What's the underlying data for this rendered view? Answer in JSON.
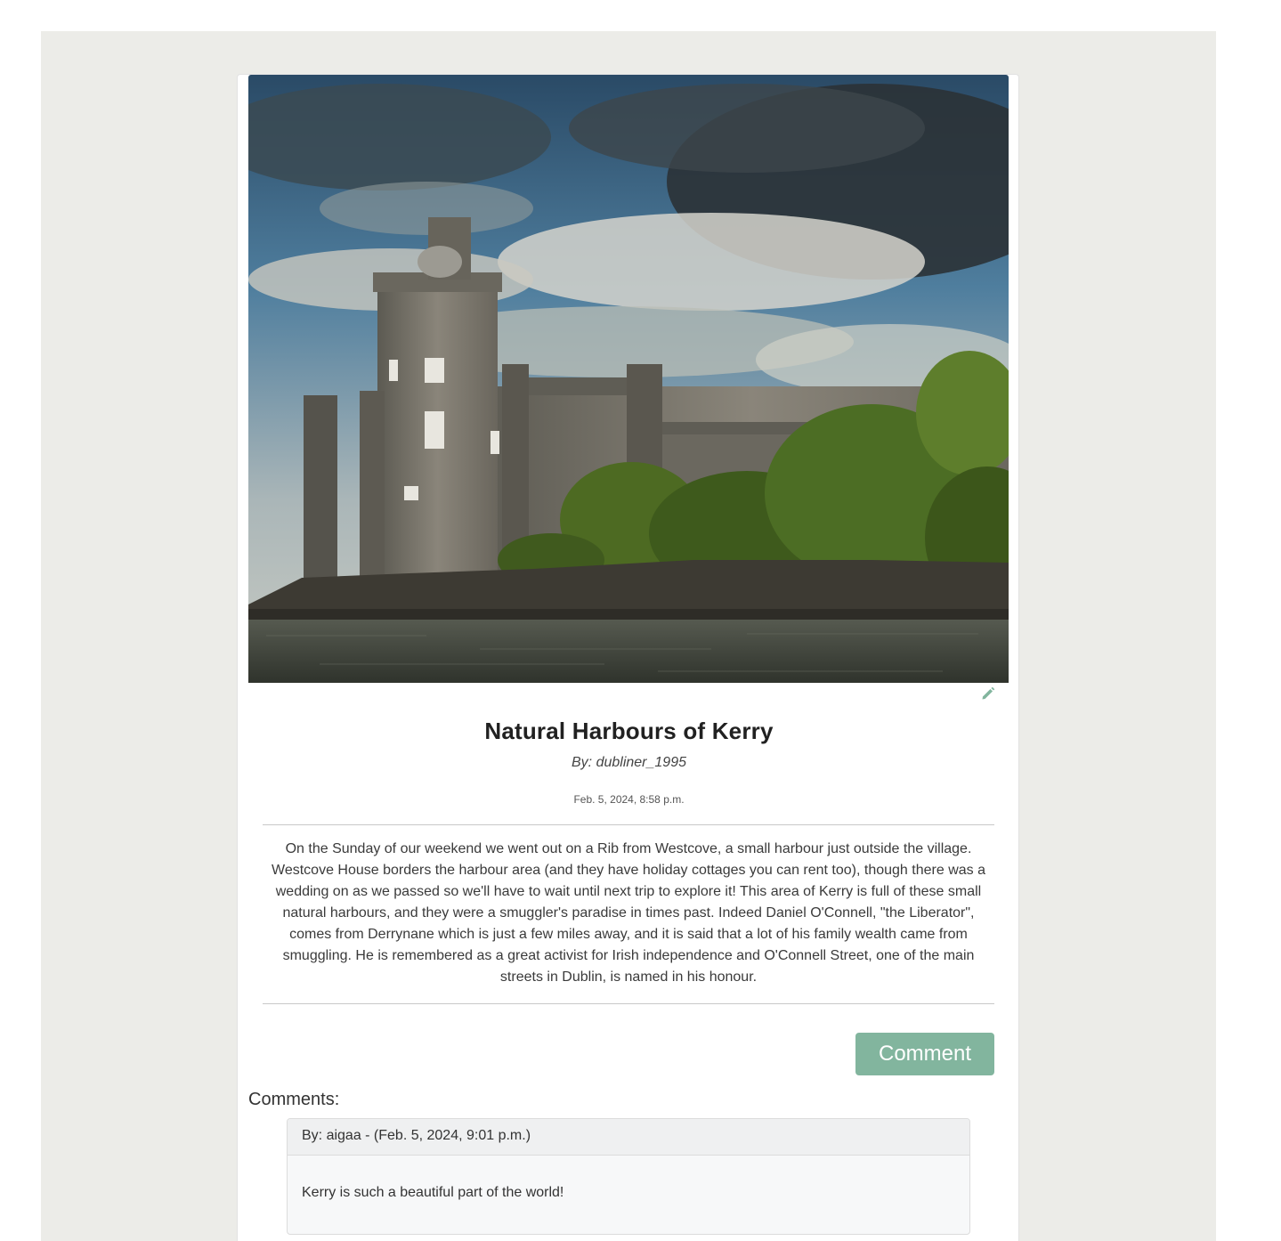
{
  "post": {
    "title": "Natural Harbours of Kerry",
    "author": "By: dubliner_1995",
    "date": "Feb. 5, 2024, 8:58 p.m.",
    "body": "On the Sunday of our weekend we went out on a Rib from Westcove, a small harbour just outside the village. Westcove House borders the harbour area (and they have holiday cottages you can rent too), though there was a wedding on as we passed so we'll have to wait until next trip to explore it! This area of Kerry is full of these small natural harbours, and they were a smuggler's paradise in times past. Indeed Daniel O'Connell, \"the Liberator\", comes from Derrynane which is just a few miles away, and it is said that a lot of his family wealth came from smuggling. He is remembered as a great activist for Irish independence and O'Connell Street, one of the main streets in Dublin, is named in his honour.",
    "edit_icon": "pencil-icon"
  },
  "actions": {
    "comment_label": "Comment"
  },
  "comments": {
    "heading": "Comments:",
    "items": [
      {
        "header": "By: aigaa - (Feb. 5, 2024, 9:01 p.m.)",
        "text": "Kerry is such a beautiful part of the world!"
      }
    ]
  },
  "colors": {
    "accent": "#82b59e",
    "page_background": "#ecece8",
    "card_background": "#ffffff"
  }
}
